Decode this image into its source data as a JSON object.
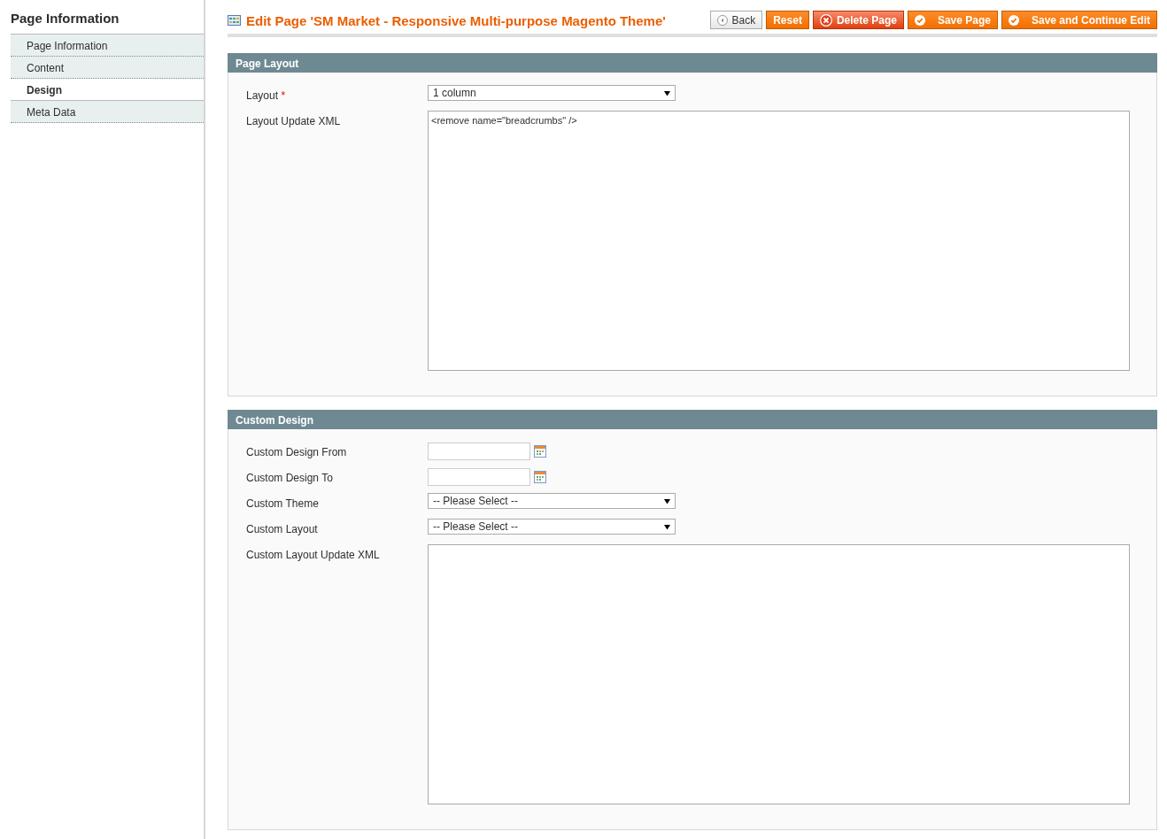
{
  "sidebar": {
    "title": "Page Information",
    "items": [
      {
        "label": "Page Information",
        "selected": false
      },
      {
        "label": "Content",
        "selected": false
      },
      {
        "label": "Design",
        "selected": true
      },
      {
        "label": "Meta Data",
        "selected": false
      }
    ]
  },
  "header": {
    "title": "Edit Page 'SM Market - Responsive Multi-purpose Magento Theme'",
    "buttons": [
      {
        "label": "Back",
        "kind": "back"
      },
      {
        "label": "Reset",
        "kind": "plain"
      },
      {
        "label": "Delete Page",
        "kind": "delete"
      },
      {
        "label": "Save Page",
        "kind": "save"
      },
      {
        "label": "Save and Continue Edit",
        "kind": "save"
      }
    ]
  },
  "sections": [
    {
      "title": "Page Layout",
      "fields": [
        {
          "label": "Layout",
          "required_mark": "*",
          "kind": "select",
          "value": "1 column"
        },
        {
          "label": "Layout Update XML",
          "kind": "textarea",
          "value": "<remove name=\"breadcrumbs\" />"
        }
      ]
    },
    {
      "title": "Custom Design",
      "fields": [
        {
          "label": "Custom Design From",
          "kind": "date"
        },
        {
          "label": "Custom Design To",
          "kind": "date"
        },
        {
          "label": "Custom Theme",
          "kind": "select",
          "value": "-- Please Select --"
        },
        {
          "label": "Custom Layout",
          "kind": "select",
          "value": "-- Please Select --"
        },
        {
          "label": "Custom Layout Update XML",
          "kind": "textarea"
        }
      ]
    }
  ]
}
